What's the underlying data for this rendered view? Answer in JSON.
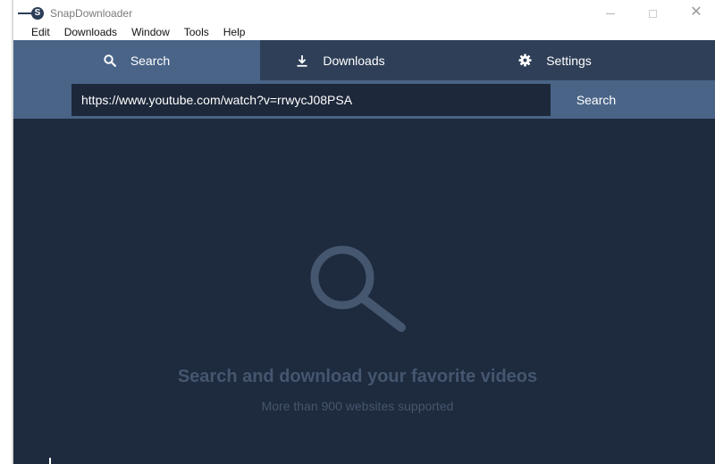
{
  "window": {
    "title": "SnapDownloader",
    "logo_letter": "S"
  },
  "menu": {
    "items": [
      "Edit",
      "Downloads",
      "Window",
      "Tools",
      "Help"
    ]
  },
  "tabs": [
    {
      "label": "Search",
      "icon": "search-icon",
      "active": true
    },
    {
      "label": "Downloads",
      "icon": "download-icon",
      "active": false
    },
    {
      "label": "Settings",
      "icon": "gear-icon",
      "active": false
    }
  ],
  "search": {
    "url_value": "https://www.youtube.com/watch?v=rrwycJ08PSA",
    "button_label": "Search"
  },
  "empty_state": {
    "icon": "search-icon",
    "headline": "Search and download your favorite videos",
    "subline": "More than 900 websites supported"
  },
  "colors": {
    "tab_bar": "#2e3f57",
    "active_tab": "#4a6488",
    "main_bg": "#1e2a3d",
    "url_input_bg": "#1d283a",
    "muted_text": "#45566f"
  }
}
